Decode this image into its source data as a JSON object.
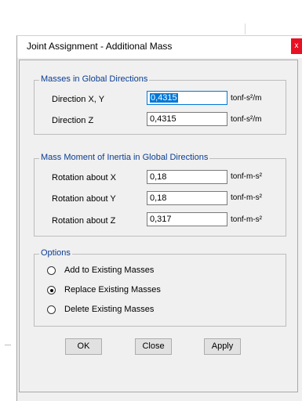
{
  "window": {
    "title": "Joint Assignment - Additional Mass",
    "close_glyph": "x"
  },
  "mass_group": {
    "label": "Masses in Global Directions",
    "rows": [
      {
        "label": "Direction  X, Y",
        "value": "0,4315",
        "unit": "tonf-s²/m"
      },
      {
        "label": "Direction  Z",
        "value": "0,4315",
        "unit": "tonf-s²/m"
      }
    ]
  },
  "inertia_group": {
    "label": "Mass Moment of Inertia in Global Directions",
    "rows": [
      {
        "label": "Rotation about  X",
        "value": "0,18",
        "unit": "tonf-m-s²"
      },
      {
        "label": "Rotation about  Y",
        "value": "0,18",
        "unit": "tonf-m-s²"
      },
      {
        "label": "Rotation about  Z",
        "value": "0,317",
        "unit": "tonf-m-s²"
      }
    ]
  },
  "options_group": {
    "label": "Options",
    "items": [
      {
        "label": "Add to Existing Masses",
        "checked": false
      },
      {
        "label": "Replace Existing Masses",
        "checked": true
      },
      {
        "label": "Delete Existing Masses",
        "checked": false
      }
    ]
  },
  "buttons": {
    "ok": "OK",
    "close": "Close",
    "apply": "Apply"
  },
  "colors": {
    "group_label": "#0b3d91",
    "selection": "#0078d7",
    "close_button": "#e81123"
  }
}
